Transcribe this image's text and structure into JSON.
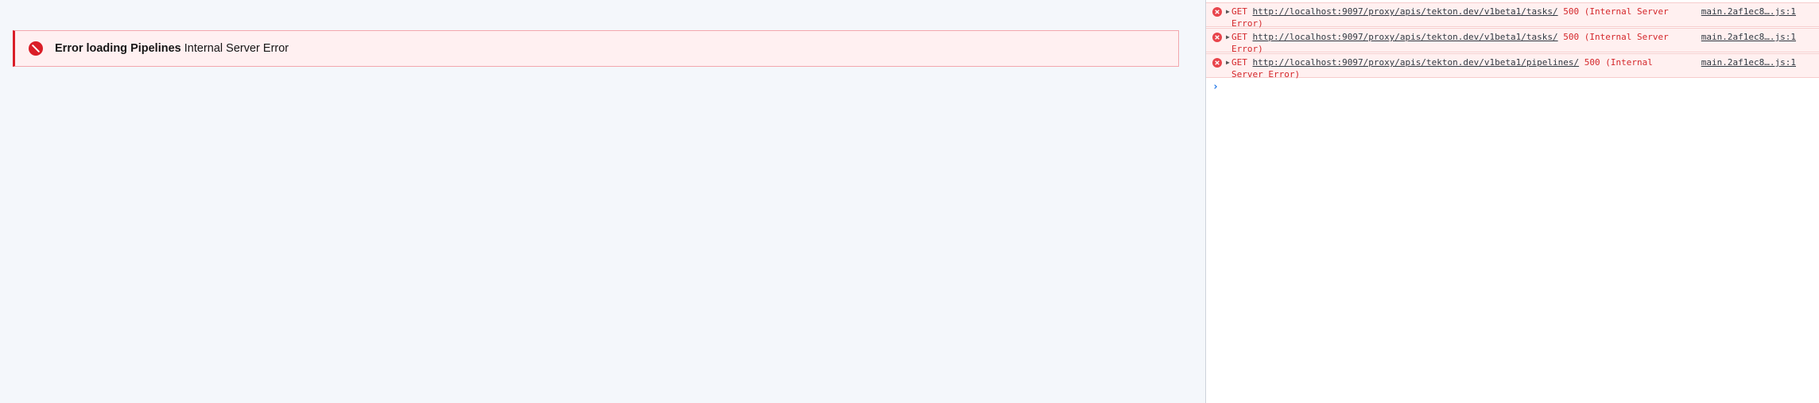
{
  "notification": {
    "title": "Error loading Pipelines",
    "subtitle": "Internal Server Error",
    "kind": "error",
    "accent_color": "#da1e28",
    "icon": "error-filled-icon"
  },
  "console": {
    "messages": [
      {
        "method": "GET",
        "url": "http://localhost:9097/proxy/apis/tekton.dev/v1beta1/tasks/",
        "status": "500 (Internal Server Error)",
        "source": "main.2af1ec8….js:1"
      },
      {
        "method": "GET",
        "url": "http://localhost:9097/proxy/apis/tekton.dev/v1beta1/tasks/",
        "status": "500 (Internal Server Error)",
        "source": "main.2af1ec8….js:1"
      },
      {
        "method": "GET",
        "url": "http://localhost:9097/proxy/apis/tekton.dev/v1beta1/pipelines/",
        "status": "500 (Internal Server Error)",
        "source": "main.2af1ec8….js:1"
      }
    ],
    "prompt_symbol": "›",
    "error_color": "#d4272b"
  }
}
